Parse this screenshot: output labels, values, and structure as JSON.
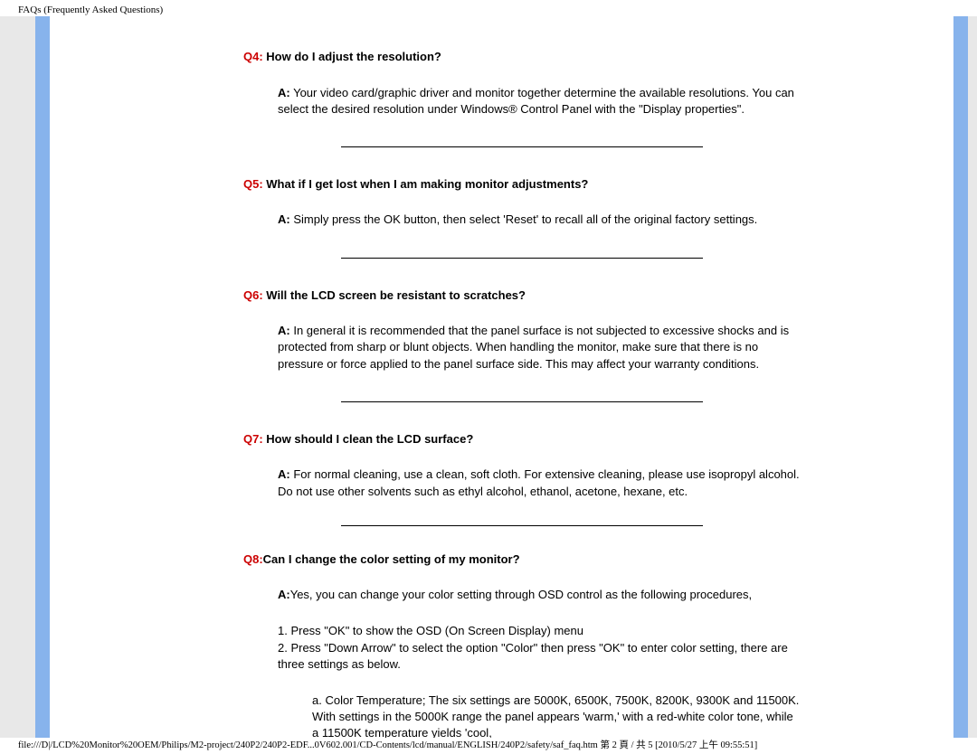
{
  "header": {
    "title": "FAQs (Frequently Asked Questions)"
  },
  "faqs": [
    {
      "q_label": "Q4:",
      "q_text": " How do I adjust the resolution?",
      "a_label": "A:",
      "a_text": " Your video card/graphic driver and monitor together determine the available resolutions. You can select the desired resolution under Windows® Control Panel with the \"Display properties\"."
    },
    {
      "q_label": "Q5:",
      "q_text": " What if I get lost when I am making monitor adjustments?",
      "a_label": "A:",
      "a_text": " Simply press the OK button, then select 'Reset' to recall all of the original factory settings."
    },
    {
      "q_label": "Q6:",
      "q_text": " Will the LCD screen be resistant to scratches?",
      "a_label": "A:",
      "a_text": " In general it is recommended that the panel surface is not subjected to excessive shocks and is protected from sharp or blunt objects. When handling the monitor, make sure that there is no pressure or force applied to the panel surface side.  This may affect your warranty conditions."
    },
    {
      "q_label": "Q7:",
      "q_text": " How should I clean the LCD surface?",
      "a_label": "A:",
      "a_text": " For normal cleaning, use a clean, soft cloth. For extensive cleaning, please use isopropyl alcohol. Do not use other solvents such as ethyl alcohol, ethanol, acetone, hexane, etc."
    },
    {
      "q_label": "Q8:",
      "q_text": "Can I change the color setting of my monitor?",
      "a_label": "A:",
      "a_text": "Yes, you can change your color setting through OSD control as the following procedures,",
      "steps": "1. Press \"OK\" to show the OSD (On Screen Display) menu\n2. Press \"Down Arrow\" to select the option \"Color\" then press \"OK\" to enter color setting, there are three settings as below.",
      "sub": "a. Color Temperature; The six settings are  5000K, 6500K, 7500K, 8200K, 9300K and 11500K. With settings in the 5000K range the panel appears 'warm,' with a red-white color tone, while a 11500K temperature yields 'cool,"
    }
  ],
  "footer": {
    "path": "file:///D|/LCD%20Monitor%20OEM/Philips/M2-project/240P2/240P2-EDF...0V602.001/CD-Contents/lcd/manual/ENGLISH/240P2/safety/saf_faq.htm 第 2 頁 / 共 5  [2010/5/27 上午 09:55:51]"
  }
}
